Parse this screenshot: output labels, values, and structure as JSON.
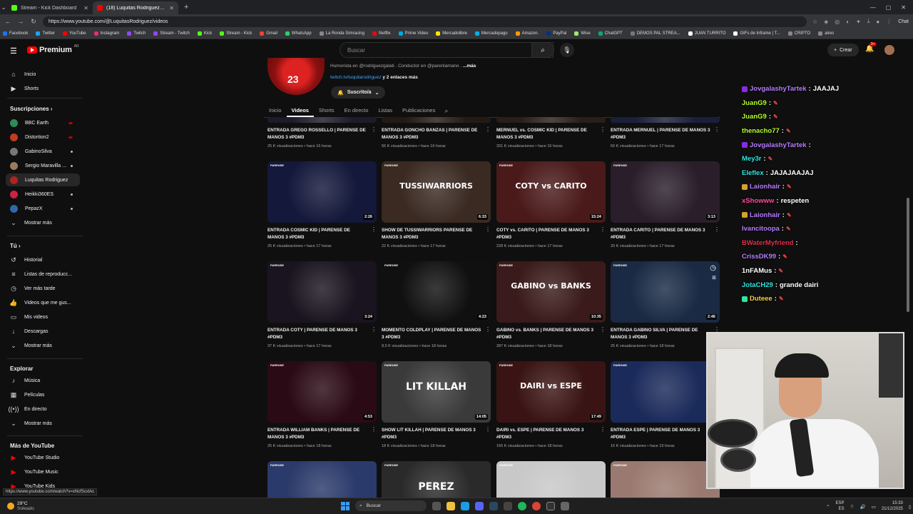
{
  "browser": {
    "tabs": [
      {
        "title": "Stream - Kick Dashboard",
        "color": "#53fc18",
        "active": false
      },
      {
        "title": "(18) Luquitas Rodriguez - YouTube",
        "color": "#ff0000",
        "active": true
      }
    ],
    "url": "https://www.youtube.com/@LuquitasRodriguez/videos",
    "chat_label": "Chat",
    "bookmarks": [
      "Facebook",
      "Twitter",
      "YouTube",
      "Instagram",
      "Twitch",
      "Stream - Twitch",
      "Kick",
      "Stream - Kick",
      "Gmail",
      "WhatsApp",
      "La Ronda Simracing",
      "Netflix",
      "Prime Video",
      "Mercadolibre",
      "Mercadopago",
      "Amazon.",
      "PayPal",
      "Wise",
      "ChatGPT",
      "DEMOS PAL STREA...",
      "JUAN TURRITO",
      "GIFs de Inframe | T...",
      "CRIPTO",
      "aires"
    ]
  },
  "header": {
    "logo_text": "Premium",
    "country": "AR",
    "search_placeholder": "Buscar",
    "create_label": "Crear",
    "notif_count": "9+"
  },
  "sidebar": {
    "top": [
      {
        "label": "Inicio",
        "icon": "home-icon",
        "glyph": "⌂"
      },
      {
        "label": "Shorts",
        "icon": "shorts-icon",
        "glyph": "▶"
      }
    ],
    "subs_header": "Suscripciones",
    "subs": [
      {
        "label": "BBC Earth",
        "color": "#2e8b57",
        "dot": "red"
      },
      {
        "label": "Distortion2",
        "color": "#c23b22",
        "dot": "red"
      },
      {
        "label": "GabinoSilva",
        "color": "#777777",
        "dot": "grey"
      },
      {
        "label": "Sergio Maravilla ...",
        "color": "#9a7b5c",
        "dot": "grey"
      },
      {
        "label": "Luquitas Rodriguez",
        "color": "#b22222",
        "dot": "",
        "active": true
      },
      {
        "label": "Heikki360ES",
        "color": "#cc2244",
        "dot": "grey"
      },
      {
        "label": "PepazX",
        "color": "#3366aa",
        "dot": "grey"
      }
    ],
    "subs_more": "Mostrar más",
    "you_header": "Tú",
    "you": [
      {
        "label": "Historial",
        "glyph": "↺"
      },
      {
        "label": "Listas de reproducc...",
        "glyph": "≡"
      },
      {
        "label": "Ver más tarde",
        "glyph": "◷"
      },
      {
        "label": "Videos que me gus...",
        "glyph": "👍"
      },
      {
        "label": "Mis videos",
        "glyph": "▭"
      },
      {
        "label": "Descargas",
        "glyph": "↓"
      }
    ],
    "you_more": "Mostrar más",
    "explore_header": "Explorar",
    "explore": [
      {
        "label": "Música",
        "glyph": "♪"
      },
      {
        "label": "Películas",
        "glyph": "▦"
      },
      {
        "label": "En directo",
        "glyph": "((•))"
      }
    ],
    "explore_more": "Mostrar más",
    "more_header": "Más de YouTube",
    "more": [
      {
        "label": "YouTube Studio"
      },
      {
        "label": "YouTube Music"
      },
      {
        "label": "YouTube Kids"
      }
    ],
    "status_url": "https://www.youtube.com/watch?v=xNcfScxlAc"
  },
  "channel": {
    "jersey_number": "23",
    "description": "Humorista en @rodriguezgalati . Conductor en @parenlamano .",
    "desc_more": "...más",
    "link": "twitch.tv/luquitarodriguez",
    "link_more": "y 2 enlaces más",
    "subscribed_label": "Suscrito/a",
    "tabs": [
      "Inicio",
      "Videos",
      "Shorts",
      "En directo",
      "Listas",
      "Publicaciones"
    ],
    "active_tab": "Videos"
  },
  "videos": [
    {
      "title": "ENTRADA GREGO ROSSELLO | PARENSE DE MANOS 3 #PDM3",
      "meta": "25 K visualizaciones • hace 16 horas",
      "duration": "",
      "bg": "#1c1c2a"
    },
    {
      "title": "ENTRADA GONCHO BANZAS | PARENSE DE MANOS 3 #PDM3",
      "meta": "56 K visualizaciones • hace 16 horas",
      "duration": "",
      "bg": "#241a14"
    },
    {
      "title": "MERNUEL vs. COSMIC KID | PARENSE DE MANOS 3 #PDM3",
      "meta": "331 K visualizaciones • hace 16 horas",
      "duration": "",
      "bg": "#2a1e18"
    },
    {
      "title": "ENTRADA MERNUEL | PARENSE DE MANOS 3 #PDM3",
      "meta": "50 K visualizaciones • hace 17 horas",
      "duration": "",
      "bg": "#1a1f3a"
    },
    {
      "title": "ENTRADA COSMIC KID | PARENSE DE MANOS 3 #PDM3",
      "meta": "25 K visualizaciones • hace 17 horas",
      "duration": "2:26",
      "bg": "#14183a",
      "art": ""
    },
    {
      "title": "SHOW DE TUSSIWARRIORS PARENSE DE MANOS 3 #PDM3",
      "meta": "22 K visualizaciones • hace 17 horas",
      "duration": "6:33",
      "bg": "#3a2a22",
      "art": "TUSSIWARRIORS"
    },
    {
      "title": "COTY vs. CARITO | PARENSE DE MANOS 3 #PDM3",
      "meta": "228 K visualizaciones • hace 17 horas",
      "duration": "15:24",
      "bg": "#4a1a1a",
      "art": "COTY vs CARITO"
    },
    {
      "title": "ENTRADA CARITO | PARENSE DE MANOS 3 #PDM3",
      "meta": "33 K visualizaciones • hace 17 horas",
      "duration": "3:13",
      "bg": "#2a1e2a",
      "art": ""
    },
    {
      "title": "ENTRADA COTY | PARENSE DE MANOS 3 #PDM3",
      "meta": "37 K visualizaciones • hace 17 horas",
      "duration": "3:24",
      "bg": "#1a1420",
      "art": ""
    },
    {
      "title": "MOMENTO COLDPLAY | PARENSE DE MANOS 3 #PDM3",
      "meta": "8,5 K visualizaciones • hace 18 horas",
      "duration": "4:23",
      "bg": "#101010",
      "art": ""
    },
    {
      "title": "GABINO vs. BANKS | PARENSE DE MANOS 3 #PDM3",
      "meta": "287 K visualizaciones • hace 18 horas",
      "duration": "10:35",
      "bg": "#3a1a1a",
      "art": "GABINO vs BANKS"
    },
    {
      "title": "ENTRADA GABINO SILVA | PARENSE DE MANOS 3 #PDM3",
      "meta": "25 K visualizaciones • hace 18 horas",
      "duration": "2:46",
      "bg": "#1a2a44",
      "art": ""
    },
    {
      "title": "ENTRADA WILLIAM BANKS | PARENSE DE MANOS 3 #PDM3",
      "meta": "25 K visualizaciones • hace 18 horas",
      "duration": "4:53",
      "bg": "#2a0a14",
      "art": ""
    },
    {
      "title": "SHOW LIT KILLAH | PARENSE DE MANOS 3 #PDM3",
      "meta": "18 K visualizaciones • hace 18 horas",
      "duration": "14:05",
      "bg": "#3a3a3a",
      "art": "LIT KILLAH"
    },
    {
      "title": "DAIRI vs. ESPE | PARENSE DE MANOS 3 #PDM3",
      "meta": "156 K visualizaciones • hace 18 horas",
      "duration": "17:49",
      "bg": "#3a1414",
      "art": "DAIRI vs ESPE"
    },
    {
      "title": "ENTRADA ESPE | PARENSE DE MANOS 3 #PDM3",
      "meta": "16 K visualizaciones • hace 19 horas",
      "duration": "",
      "bg": "#1a2a5a",
      "art": ""
    },
    {
      "title": "",
      "meta": "",
      "duration": "",
      "bg": "#2a3a6a",
      "art": ""
    },
    {
      "title": "",
      "meta": "",
      "duration": "",
      "bg": "#2a2a2a",
      "art": "PEREZ"
    },
    {
      "title": "",
      "meta": "",
      "duration": "",
      "bg": "#c8c8c8",
      "art": ""
    },
    {
      "title": "",
      "meta": "",
      "duration": "",
      "bg": "#9a7a70",
      "art": ""
    }
  ],
  "chat": [
    {
      "user": "JovgalashyTartek",
      "color": "#b57cff",
      "msg": "JAAJAJ",
      "badge": "#8a2be2"
    },
    {
      "user": "JuanG9",
      "color": "#b5ff2a",
      "msg": "",
      "emote": true
    },
    {
      "user": "JuanG9",
      "color": "#b5ff2a",
      "msg": "",
      "emote": true
    },
    {
      "user": "thenacho77",
      "color": "#b5ff2a",
      "msg": "",
      "emote": true
    },
    {
      "user": "JovgalashyTartek",
      "color": "#b57cff",
      "msg": "",
      "badge": "#8a2be2"
    },
    {
      "user": "Mey3r",
      "color": "#2ae8e0",
      "msg": "",
      "emote": true
    },
    {
      "user": "Eleflex",
      "color": "#2ae8e0",
      "msg": "JAJAJAAJAJ"
    },
    {
      "user": "Laionhair",
      "color": "#b57cff",
      "msg": "",
      "badge": "#d4a12a",
      "emote": true
    },
    {
      "user": "xShowww",
      "color": "#ff4aa0",
      "msg": "respeten"
    },
    {
      "user": "Laionhair",
      "color": "#b57cff",
      "msg": "",
      "badge": "#d4a12a",
      "emote": true
    },
    {
      "user": "Ivancitoopa",
      "color": "#b57cff",
      "msg": "",
      "emote": true
    },
    {
      "user": "BWaterMyfriend",
      "color": "#e0304a",
      "msg": ""
    },
    {
      "user": "CrissDK99",
      "color": "#b57cff",
      "msg": "",
      "emote": true
    },
    {
      "user": "1nFAMus",
      "color": "#ffffff",
      "msg": "",
      "emote": true
    },
    {
      "user": "JotaCH29",
      "color": "#2ae8e0",
      "msg": "grande dairi"
    },
    {
      "user": "Duteee",
      "color": "#f5d142",
      "msg": "",
      "badge": "#2ae8a0",
      "emote": true
    }
  ],
  "taskbar": {
    "temp": "29°C",
    "weather": "Soleado",
    "search": "Buscar",
    "lang1": "ESP",
    "lang2": "ES",
    "time": "15:33",
    "date": "21/12/2025"
  }
}
